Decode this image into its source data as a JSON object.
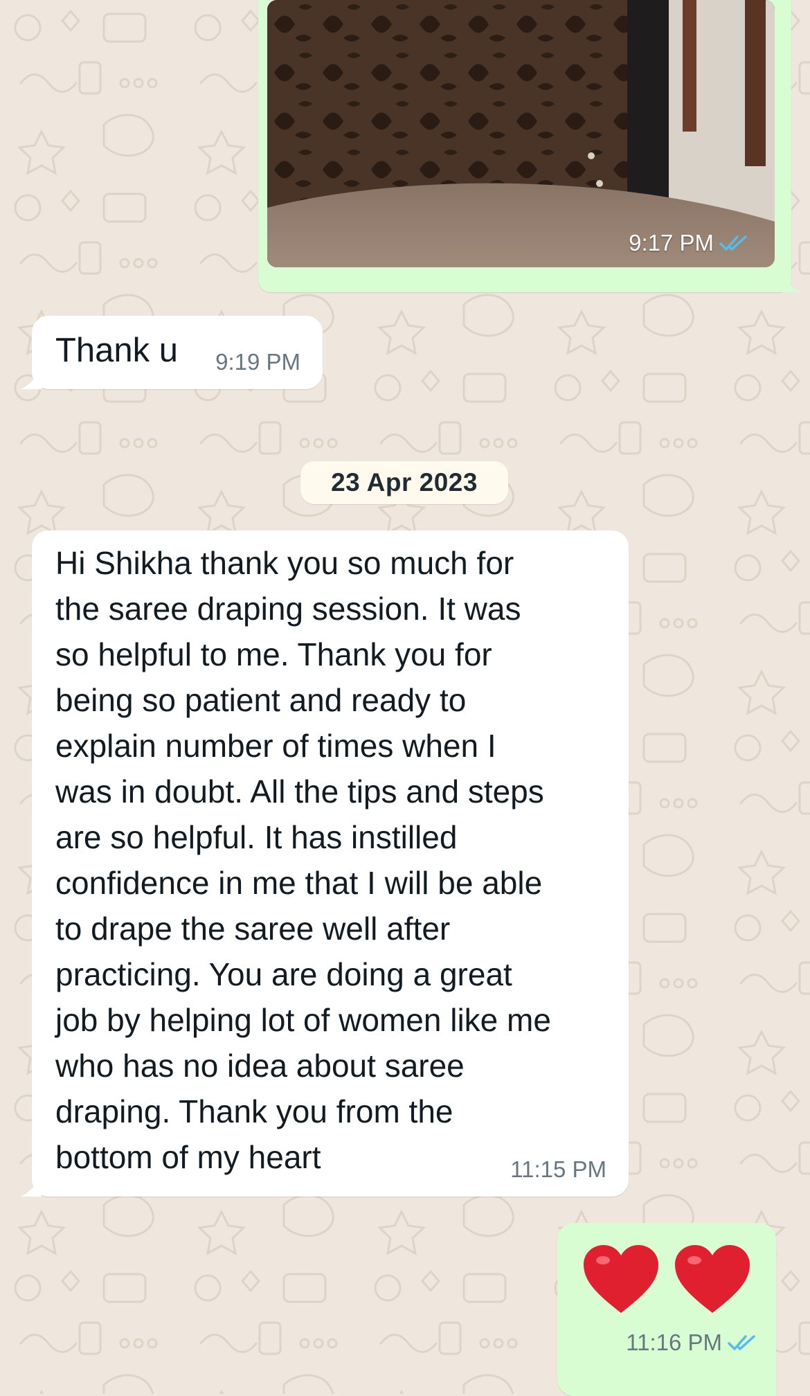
{
  "colors": {
    "outgoing_bubble": "#d9fdd3",
    "incoming_bubble": "#ffffff",
    "chat_background": "#efe7dd",
    "read_receipt": "#53bdeb",
    "heart": "#e0202e"
  },
  "messages": {
    "photo": {
      "time": "9:17 PM",
      "status_icon": "double-check-read-icon"
    },
    "thanks": {
      "text": "Thank u",
      "time": "9:19 PM"
    },
    "date_separator": "23 Apr 2023",
    "long": {
      "lines": [
        "Hi Shikha thank you so much for",
        "the saree draping session. It was",
        "so helpful to me. Thank you for",
        "being so patient and ready to",
        "explain number of times when I",
        "was in doubt. All the tips and steps",
        "are so helpful. It has instilled",
        "confidence in me that I will be able",
        "to drape the saree well after",
        "practicing. You are doing a great",
        "job by helping lot of women like me",
        "who has no idea about saree",
        "draping. Thank you from the",
        "bottom of my heart"
      ],
      "time": "11:15 PM"
    },
    "hearts": {
      "emoji": [
        "red-heart-icon",
        "red-heart-icon"
      ],
      "time": "11:16 PM",
      "status_icon": "double-check-read-icon"
    }
  }
}
